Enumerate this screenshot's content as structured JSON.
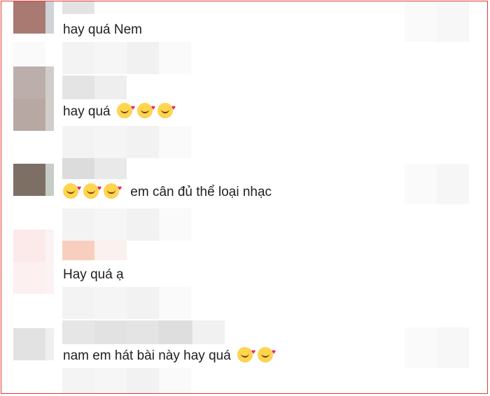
{
  "comments": [
    {
      "text": "hay quá Nem",
      "emoji_before": 0,
      "emoji_after": 0
    },
    {
      "text": "hay quá",
      "emoji_before": 0,
      "emoji_after": 3
    },
    {
      "text": "em cân đủ thể loại nhạc",
      "emoji_before": 3,
      "emoji_after": 0
    },
    {
      "text": "Hay quá ạ",
      "emoji_before": 0,
      "emoji_after": 0
    },
    {
      "text": "nam em hát bài này hay quá",
      "emoji_before": 0,
      "emoji_after": 2
    }
  ],
  "emoji_icon": "smiling-face-with-hearts-icon",
  "frame_color": "#e53935"
}
